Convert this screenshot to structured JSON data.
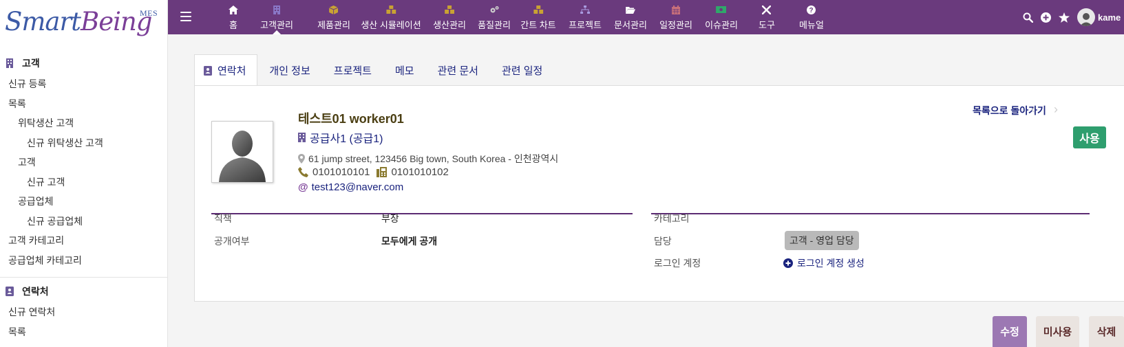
{
  "logo": {
    "part1": "Smart",
    "part2": "Being",
    "suffix": "MES"
  },
  "sidebar": {
    "customer_section": "고객",
    "customer_items": [
      {
        "label": "신규 등록"
      },
      {
        "label": "목록"
      },
      {
        "label": "위탁생산 고객"
      },
      {
        "label": "신규 위탁생산 고객"
      },
      {
        "label": "고객"
      },
      {
        "label": "신규 고객"
      },
      {
        "label": "공급업체"
      },
      {
        "label": "신규 공급업체"
      },
      {
        "label": "고객 카테고리"
      },
      {
        "label": "공급업체 카테고리"
      }
    ],
    "contact_section": "연락처",
    "contact_items": [
      {
        "label": "신규 연락처"
      },
      {
        "label": "목록"
      }
    ]
  },
  "topbar": {
    "menu": [
      {
        "label": "홈",
        "icon": "home-icon"
      },
      {
        "label": "고객관리",
        "icon": "building-icon"
      },
      {
        "label": "제품관리",
        "icon": "cube-icon"
      },
      {
        "label": "생산 시뮬레이션",
        "icon": "cubes-icon"
      },
      {
        "label": "생산관리",
        "icon": "cubes-icon"
      },
      {
        "label": "품질관리",
        "icon": "cogs-icon"
      },
      {
        "label": "간트 차트",
        "icon": "cubes-icon"
      },
      {
        "label": "프로젝트",
        "icon": "sitemap-icon"
      },
      {
        "label": "문서관리",
        "icon": "folder-open-icon"
      },
      {
        "label": "일정관리",
        "icon": "calendar-icon"
      },
      {
        "label": "이슈관리",
        "icon": "money-icon"
      },
      {
        "label": "도구",
        "icon": "tools-icon"
      },
      {
        "label": "메뉴얼",
        "icon": "question-circle-icon"
      }
    ],
    "user": "kame"
  },
  "tabs": [
    {
      "label": "연락처"
    },
    {
      "label": "개인 정보"
    },
    {
      "label": "프로젝트"
    },
    {
      "label": "메모"
    },
    {
      "label": "관련 문서"
    },
    {
      "label": "관련 일정"
    }
  ],
  "contact": {
    "name": "테스트01 worker01",
    "company": "공급사1 (공급1)",
    "address": "61 jump street, 123456 Big town, South Korea - 인천광역시",
    "phone": "0101010101",
    "fax": "0101010102",
    "email": "test123@naver.com",
    "back_link": "목록으로 돌아가기",
    "status": "사용"
  },
  "details_left": [
    {
      "label": "직책",
      "value": "부장"
    },
    {
      "label": "공개여부",
      "value": "모두에게 공개"
    }
  ],
  "details_right": {
    "category_label": "카테고리",
    "owner_label": "담당",
    "owner_tag": "고객 - 영업 담당",
    "login_label": "로그인 계정",
    "login_action": "로그인 계정 생성"
  },
  "actions": {
    "edit": "수정",
    "disable": "미사용",
    "delete": "삭제"
  },
  "colors": {
    "topbar": "#6a3a7d",
    "accent": "#5b2a72",
    "status": "#2e9e6e",
    "link": "#1a237e"
  }
}
